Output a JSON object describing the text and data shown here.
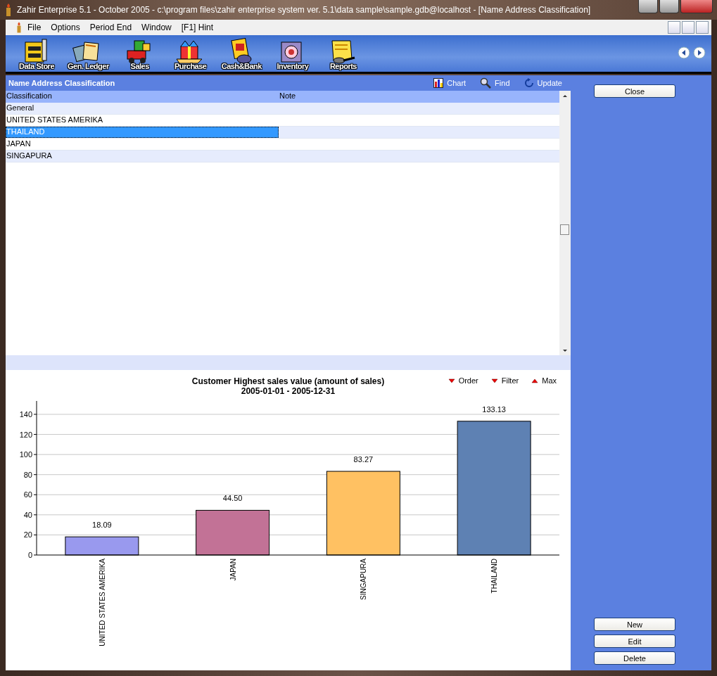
{
  "window": {
    "title": "Zahir Enterprise 5.1 - October 2005 - c:\\program files\\zahir enterprise system ver. 5.1\\data sample\\sample.gdb@localhost - [Name Address Classification]"
  },
  "menu": [
    "File",
    "Options",
    "Period End",
    "Window",
    "[F1] Hint"
  ],
  "toolbar": [
    "Data Store",
    "Gen. Ledger",
    "Sales",
    "Purchase",
    "Cash&Bank",
    "Inventory",
    "Reports"
  ],
  "panel": {
    "title": "Name Address Classification",
    "actions": [
      {
        "label": "Chart",
        "kind": "chart"
      },
      {
        "label": "Find",
        "kind": "find"
      },
      {
        "label": "Update",
        "kind": "update"
      }
    ]
  },
  "table": {
    "columns": [
      "Classification",
      "Note"
    ],
    "rows": [
      {
        "classification": "General",
        "selected": false
      },
      {
        "classification": "UNITED STATES AMERIKA",
        "selected": false
      },
      {
        "classification": "THAILAND",
        "selected": true
      },
      {
        "classification": "JAPAN",
        "selected": false
      },
      {
        "classification": "SINGAPURA",
        "selected": false
      }
    ]
  },
  "chart": {
    "subtitle": "2005-01-01 - 2005-12-31",
    "controls": [
      {
        "label": "Order",
        "kind": "down"
      },
      {
        "label": "Filter",
        "kind": "down"
      },
      {
        "label": "Max",
        "kind": "up"
      }
    ],
    "bars": [
      {
        "color": "#9999ee"
      },
      {
        "color": "#c27296"
      },
      {
        "color": "#ffc162"
      },
      {
        "color": "#5e81b3"
      }
    ],
    "chart_data": {
      "type": "bar",
      "title": "Customer Highest sales value (amount of sales)",
      "categories": [
        "UNITED STATES AMERIKA",
        "JAPAN",
        "SINGAPURA",
        "THAILAND"
      ],
      "values": [
        18.09,
        44.5,
        83.27,
        133.13
      ],
      "grid": true,
      "ylim": [
        0,
        140
      ],
      "yticks": [
        0,
        20,
        40,
        60,
        80,
        100,
        120,
        140
      ],
      "value_labels": [
        "18.09",
        "44.50",
        "83.27",
        "133.13"
      ]
    }
  },
  "sidebar": {
    "top_buttons": [
      "Close"
    ],
    "bottom_buttons": [
      "New",
      "Edit",
      "Delete"
    ]
  }
}
